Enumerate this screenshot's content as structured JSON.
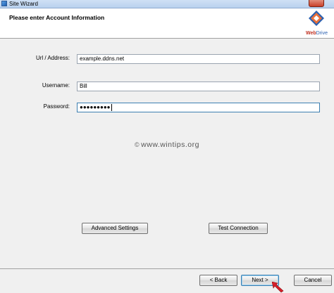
{
  "window": {
    "title": "Site Wizard"
  },
  "header": {
    "title": "Please enter Account Information",
    "logo": {
      "brand_part1": "Web",
      "brand_part2": "Drive",
      "icon": "webdrive-logo-icon"
    }
  },
  "form": {
    "url": {
      "label": "Url / Address:",
      "value": "example.ddns.net"
    },
    "username": {
      "label": "Username:",
      "value": "Bill"
    },
    "password": {
      "label": "Password:",
      "masked_value": "●●●●●●●●●"
    }
  },
  "watermark": {
    "symbol": "©",
    "text": "www.wintips.org"
  },
  "buttons": {
    "advanced_settings": "Advanced Settings",
    "test_connection": "Test Connection",
    "back": "< Back",
    "next": "Next >",
    "cancel": "Cancel"
  },
  "colors": {
    "accent_border": "#3c7fb1",
    "cursor_red": "#d81f2a",
    "logo_red": "#c03020",
    "logo_blue": "#2a60b0"
  }
}
